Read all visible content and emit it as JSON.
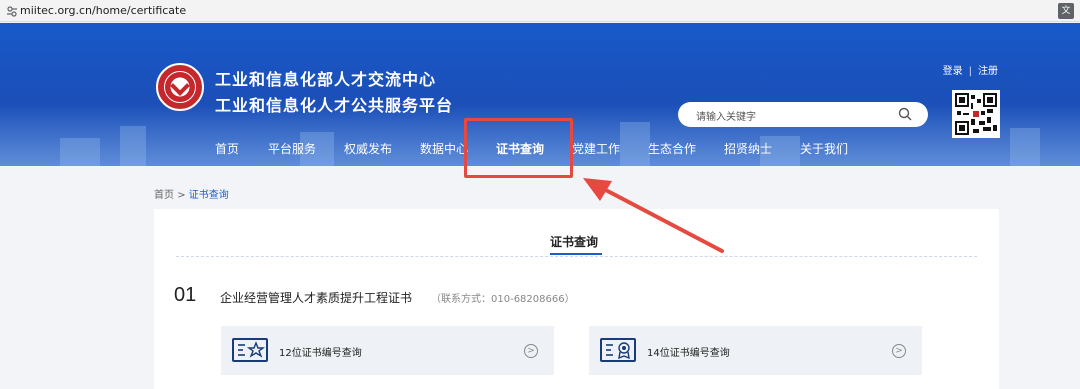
{
  "browser": {
    "url": "miitec.org.cn/home/certificate"
  },
  "header": {
    "title_line1": "工业和信息化部人才交流中心",
    "title_line2": "工业和信息化人才公共服务平台",
    "login": "登录",
    "separator": "|",
    "register": "注册",
    "search_placeholder": "请输入关键字"
  },
  "nav": [
    {
      "label": "首页"
    },
    {
      "label": "平台服务"
    },
    {
      "label": "权威发布"
    },
    {
      "label": "数据中心"
    },
    {
      "label": "证书查询"
    },
    {
      "label": "党建工作"
    },
    {
      "label": "生态合作"
    },
    {
      "label": "招贤纳士"
    },
    {
      "label": "关于我们"
    }
  ],
  "breadcrumb": {
    "home": "首页",
    "sep": ">",
    "current": "证书查询"
  },
  "main": {
    "section_title": "证书查询",
    "items": [
      {
        "number": "01",
        "name": "企业经营管理人才素质提升工程证书",
        "contact": "（联系方式：010-68208666）",
        "queries": [
          {
            "label": "12位证书编号查询",
            "icon": "certificate-star-icon"
          },
          {
            "label": "14位证书编号查询",
            "icon": "certificate-medal-icon"
          }
        ]
      }
    ]
  },
  "colors": {
    "header_blue": "#1c4fb8",
    "accent_blue": "#1d5fc7",
    "highlight_red": "#e5493f"
  }
}
